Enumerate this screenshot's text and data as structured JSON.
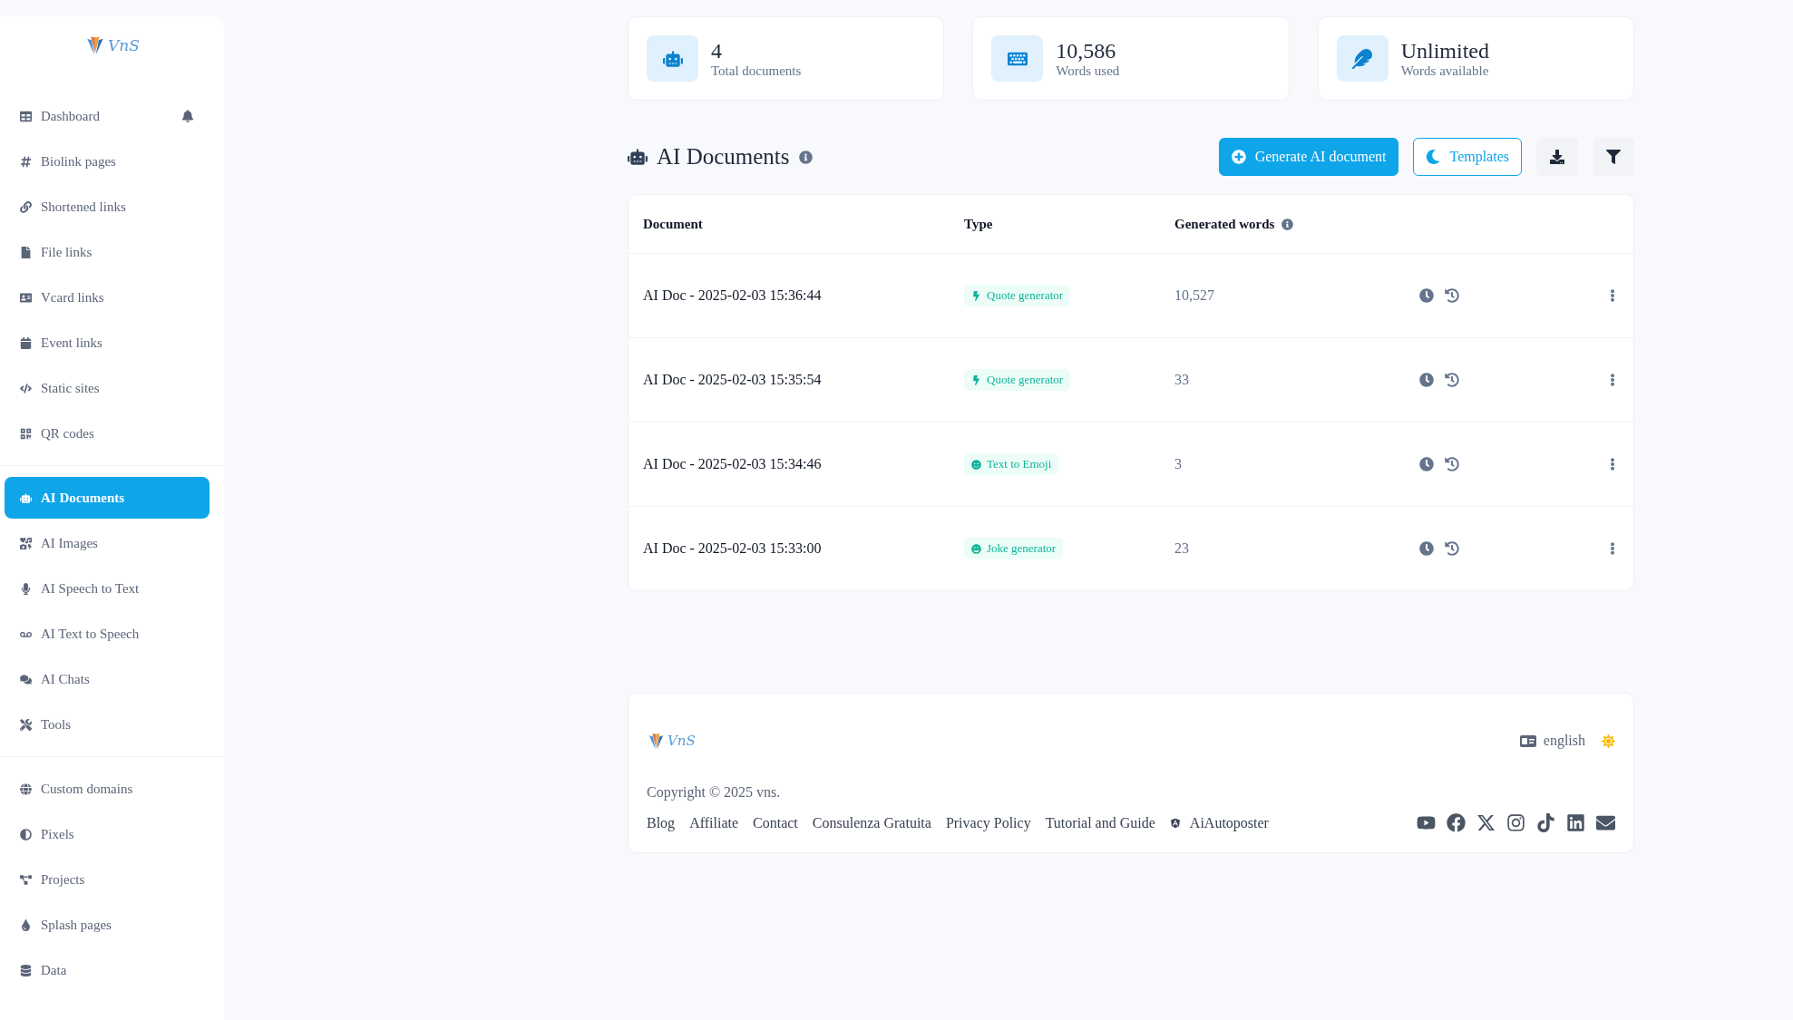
{
  "sidebar": {
    "logo": "VnS",
    "sections": [
      {
        "items": [
          {
            "label": "Dashboard",
            "selected": false
          },
          {
            "label": "Biolink pages",
            "selected": false
          },
          {
            "label": "Shortened links",
            "selected": false
          },
          {
            "label": "File links",
            "selected": false
          },
          {
            "label": "Vcard links",
            "selected": false
          },
          {
            "label": "Event links",
            "selected": false
          },
          {
            "label": "Static sites",
            "selected": false
          },
          {
            "label": "QR codes",
            "selected": false
          }
        ]
      },
      {
        "items": [
          {
            "label": "AI Documents",
            "selected": true
          },
          {
            "label": "AI Images",
            "selected": false
          },
          {
            "label": "AI Speech to Text",
            "selected": false
          },
          {
            "label": "AI Text to Speech",
            "selected": false
          },
          {
            "label": "AI Chats",
            "selected": false
          },
          {
            "label": "Tools",
            "selected": false
          }
        ]
      },
      {
        "items": [
          {
            "label": "Custom domains",
            "selected": false
          },
          {
            "label": "Pixels",
            "selected": false
          },
          {
            "label": "Projects",
            "selected": false
          },
          {
            "label": "Splash pages",
            "selected": false
          },
          {
            "label": "Data",
            "selected": false
          }
        ]
      }
    ]
  },
  "stats": [
    {
      "value": "4",
      "label": "Total documents"
    },
    {
      "value": "10,586",
      "label": "Words used"
    },
    {
      "value": "Unlimited",
      "label": "Words available"
    }
  ],
  "header": {
    "title": "AI Documents",
    "buttons": [
      {
        "kind": "primary",
        "label": "Generate AI document"
      },
      {
        "kind": "outline",
        "label": "Templates"
      },
      {
        "kind": "download"
      },
      {
        "kind": "filter"
      }
    ]
  },
  "table": {
    "columns": [
      "Document",
      "Type",
      "Generated words"
    ],
    "rows": [
      {
        "document": "AI Doc - 2025-02-03 15:36:44",
        "type": {
          "label": "Quote generator",
          "kind": "bolt"
        },
        "words": "10,527"
      },
      {
        "document": "AI Doc - 2025-02-03 15:35:54",
        "type": {
          "label": "Quote generator",
          "kind": "bolt"
        },
        "words": "33"
      },
      {
        "document": "AI Doc - 2025-02-03 15:34:46",
        "type": {
          "label": "Text to Emoji",
          "kind": "wink"
        },
        "words": "3"
      },
      {
        "document": "AI Doc - 2025-02-03 15:33:00",
        "type": {
          "label": "Joke generator",
          "kind": "grin"
        },
        "words": "23"
      }
    ]
  },
  "footer": {
    "logo": "VnS",
    "language": "english",
    "copyright": "Copyright © 2025 vns.",
    "links": [
      {
        "label": "Blog",
        "kind": "plain"
      },
      {
        "label": "Affiliate",
        "kind": "plain"
      },
      {
        "label": "Contact",
        "kind": "plain"
      },
      {
        "label": "Consulenza Gratuita",
        "kind": "plain"
      },
      {
        "label": "Privacy Policy",
        "kind": "plain"
      },
      {
        "label": "Tutorial and Guide",
        "kind": "plain"
      },
      {
        "label": "AiAutoposter",
        "kind": "badge"
      }
    ]
  }
}
